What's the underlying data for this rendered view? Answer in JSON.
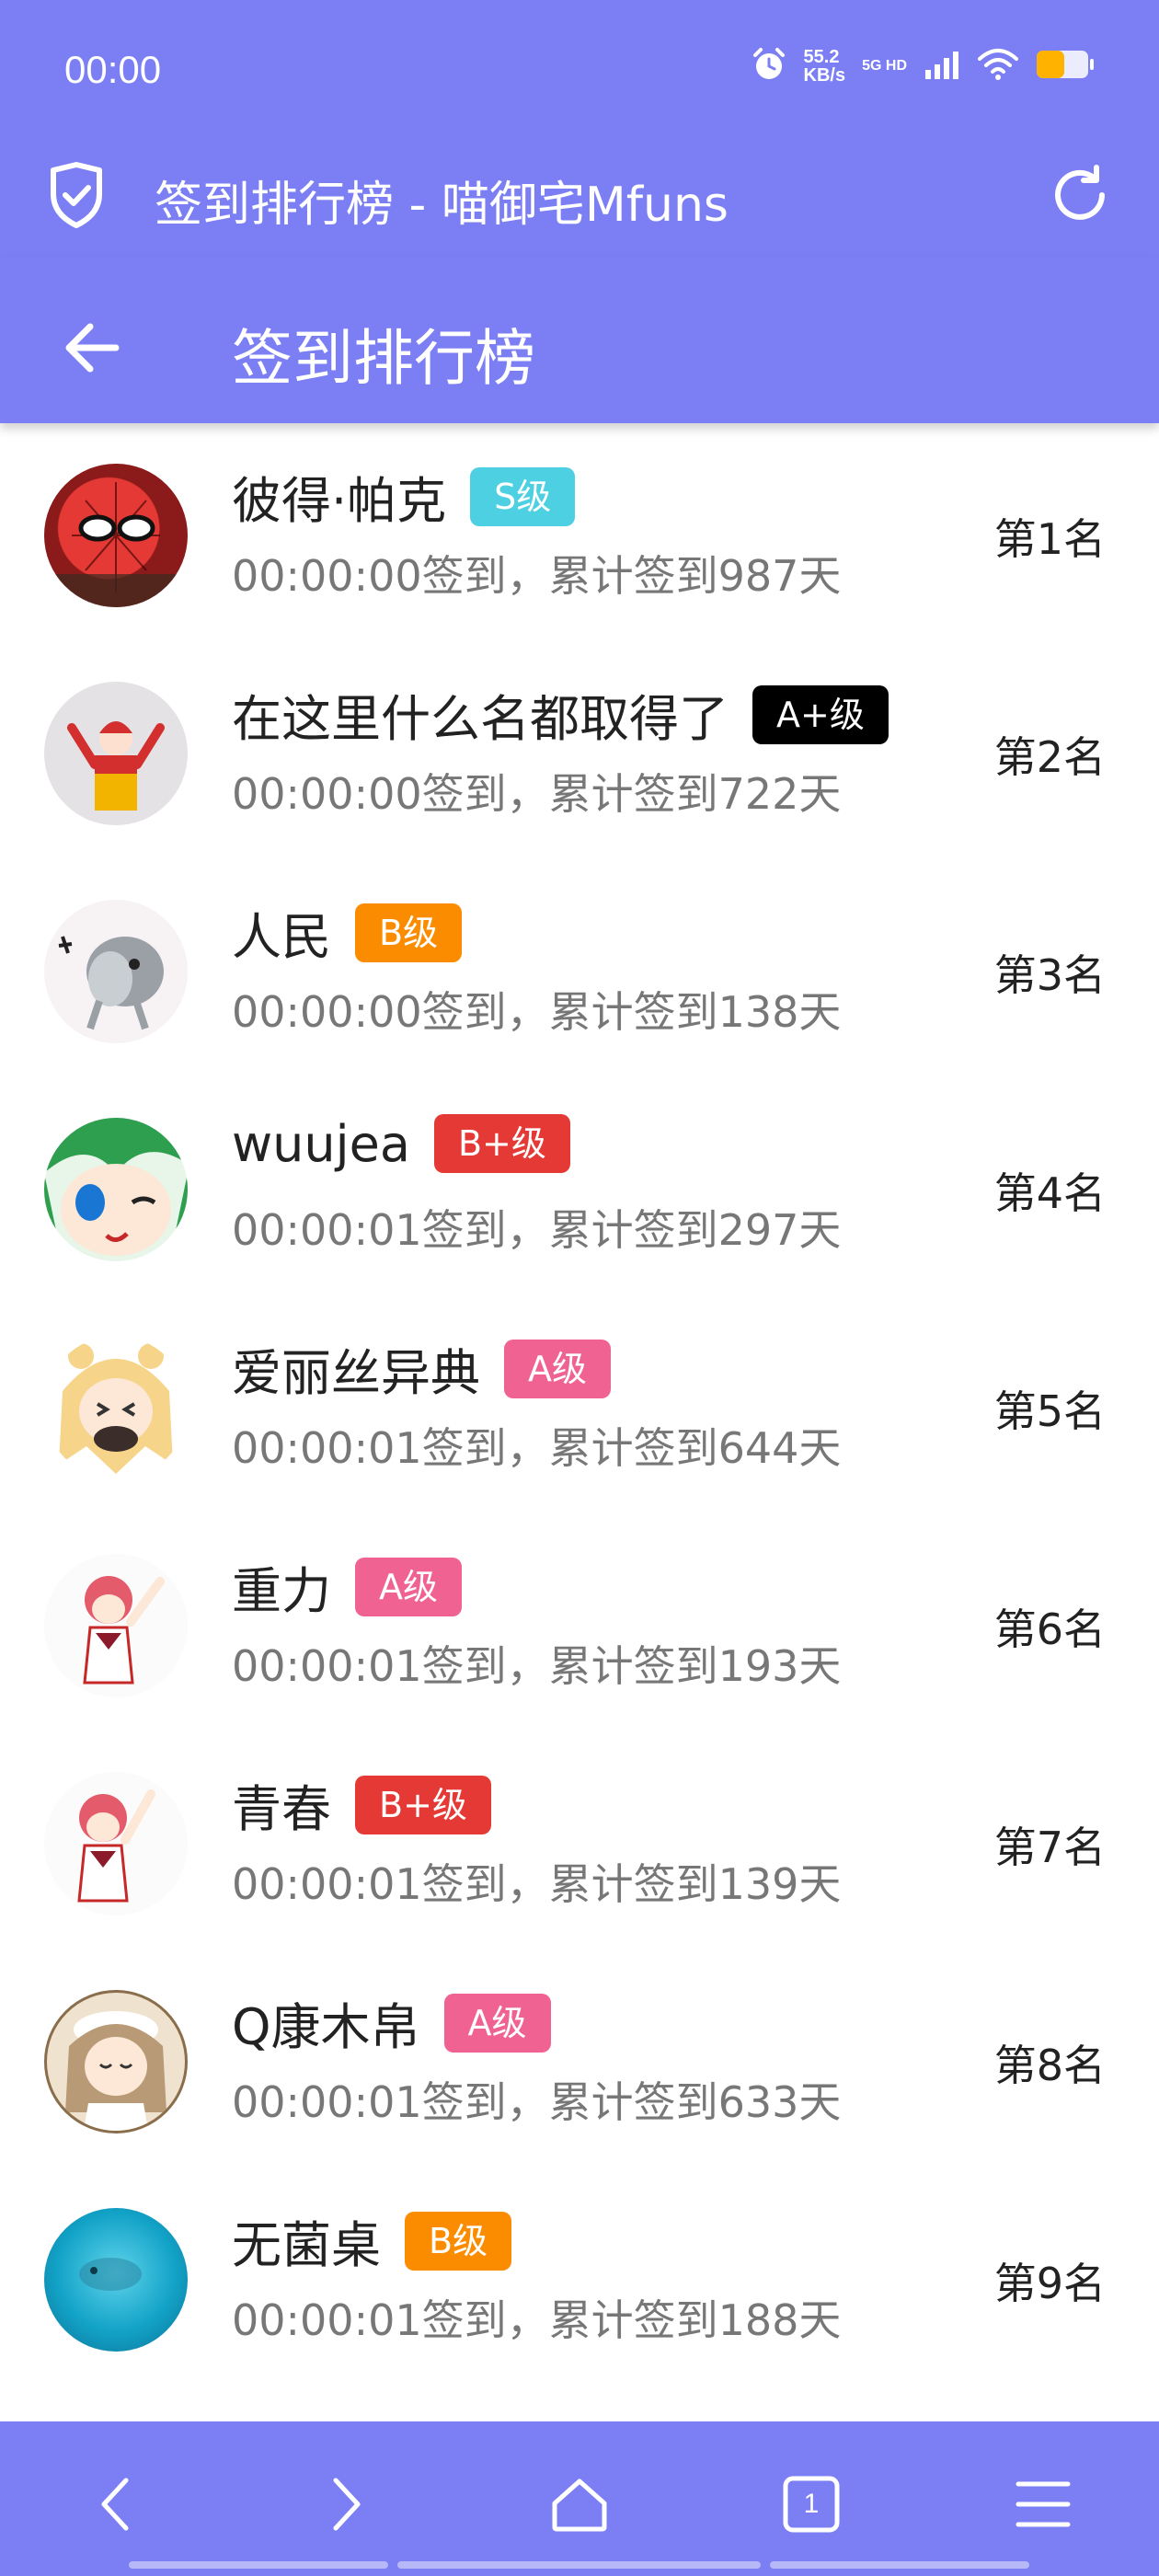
{
  "status_bar": {
    "time": "00:00",
    "speed_value": "55.2",
    "speed_unit": "KB/s",
    "network": "5G HD",
    "icons": [
      "alarm-icon",
      "signal-icon",
      "wifi-icon",
      "battery-icon"
    ]
  },
  "browser": {
    "title": "签到排行榜 - 喵御宅Mfuns",
    "icons": [
      "shield-check-icon",
      "reload-icon"
    ]
  },
  "header": {
    "title": "签到排行榜",
    "back_icon": "arrow-left-icon"
  },
  "colors": {
    "primary": "#7b7ff3",
    "badge_S": "#4dd0e1",
    "badge_A_plus": "#000000",
    "badge_B": "#fb8c00",
    "badge_B_plus": "#e53935",
    "badge_A": "#f06292"
  },
  "users": [
    {
      "name": "彼得·帕克",
      "badge": "S级",
      "badge_color": "#4dd0e1",
      "subtitle": "00:00:00签到，累计签到987天",
      "rank": "第1名"
    },
    {
      "name": "在这里什么名都取得了",
      "badge": "A+级",
      "badge_color": "#000000",
      "subtitle": "00:00:00签到，累计签到722天",
      "rank": "第2名"
    },
    {
      "name": "人民",
      "badge": "B级",
      "badge_color": "#fb8c00",
      "subtitle": "00:00:00签到，累计签到138天",
      "rank": "第3名"
    },
    {
      "name": "wuujea",
      "badge": "B+级",
      "badge_color": "#e53935",
      "subtitle": "00:00:01签到，累计签到297天",
      "rank": "第4名"
    },
    {
      "name": "爱丽丝异典",
      "badge": "A级",
      "badge_color": "#f06292",
      "subtitle": "00:00:01签到，累计签到644天",
      "rank": "第5名"
    },
    {
      "name": "重力",
      "badge": "A级",
      "badge_color": "#f06292",
      "subtitle": "00:00:01签到，累计签到193天",
      "rank": "第6名"
    },
    {
      "name": "青春",
      "badge": "B+级",
      "badge_color": "#e53935",
      "subtitle": "00:00:01签到，累计签到139天",
      "rank": "第7名"
    },
    {
      "name": "Q康木帛",
      "badge": "A级",
      "badge_color": "#f06292",
      "subtitle": "00:00:01签到，累计签到633天",
      "rank": "第8名"
    },
    {
      "name": "无菌桌",
      "badge": "B级",
      "badge_color": "#fb8c00",
      "subtitle": "00:00:01签到，累计签到188天",
      "rank": "第9名"
    }
  ],
  "bottom_nav": {
    "tab_count": "1",
    "icons": [
      "back-icon",
      "forward-icon",
      "home-icon",
      "tabs-icon",
      "menu-icon"
    ]
  }
}
